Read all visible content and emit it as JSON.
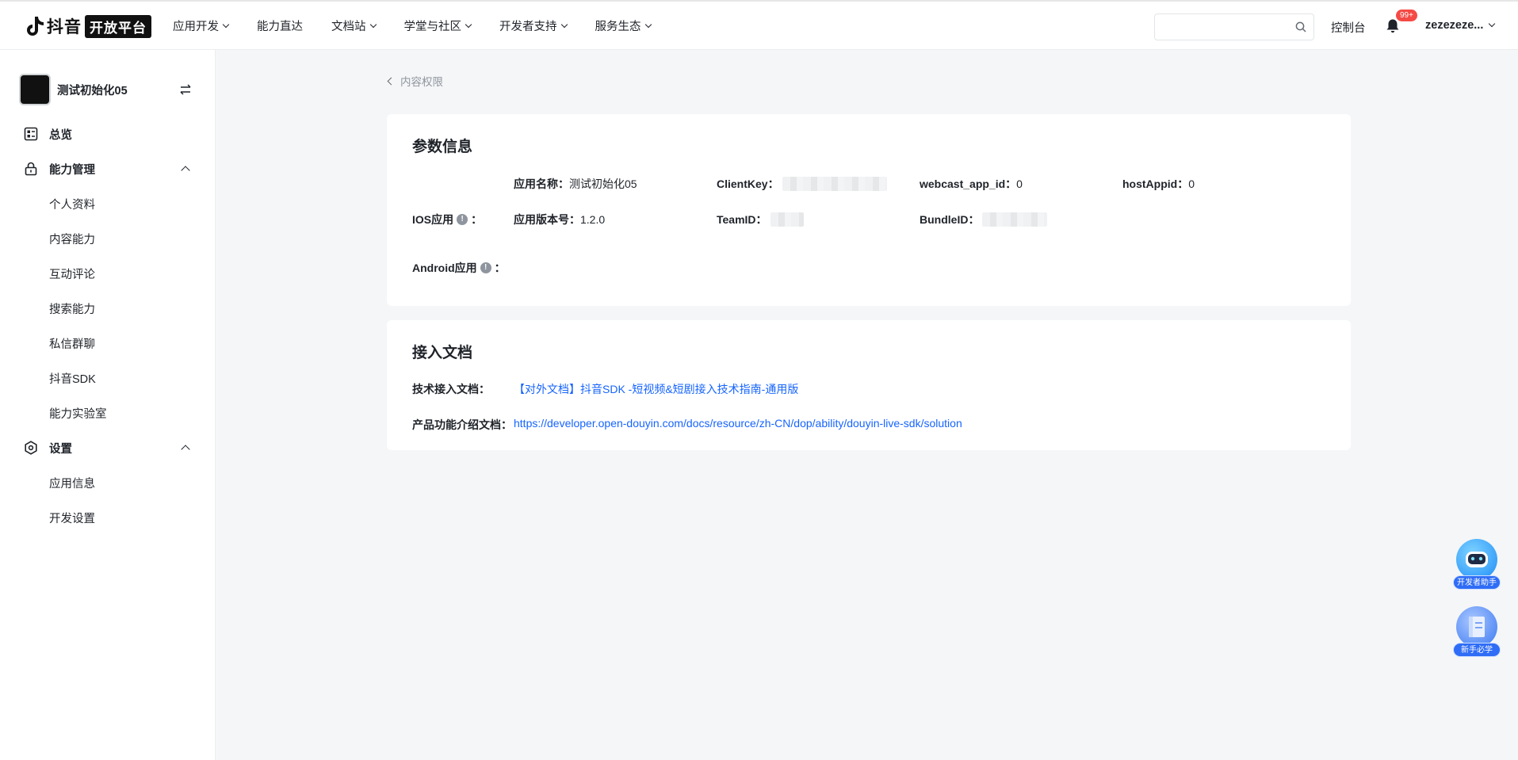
{
  "header": {
    "logo_text": "抖音",
    "logo_badge": "开放平台",
    "nav": [
      {
        "label": "应用开发",
        "dropdown": true
      },
      {
        "label": "能力直达",
        "dropdown": false
      },
      {
        "label": "文档站",
        "dropdown": true
      },
      {
        "label": "学堂与社区",
        "dropdown": true
      },
      {
        "label": "开发者支持",
        "dropdown": true
      },
      {
        "label": "服务生态",
        "dropdown": true
      }
    ],
    "search_placeholder": "",
    "console_label": "控制台",
    "notification_count": "99+",
    "username": "zezezeze..."
  },
  "sidebar": {
    "app_name": "测试初始化05",
    "groups": [
      {
        "label": "总览",
        "icon": "dashboard-icon"
      },
      {
        "label": "能力管理",
        "icon": "lock-icon",
        "expanded": true,
        "items": [
          "个人资料",
          "内容能力",
          "互动评论",
          "搜索能力",
          "私信群聊",
          "抖音SDK",
          "能力实验室"
        ]
      },
      {
        "label": "设置",
        "icon": "settings-icon",
        "expanded": true,
        "items": [
          "应用信息",
          "开发设置"
        ]
      }
    ]
  },
  "breadcrumb": {
    "label": "内容权限"
  },
  "params": {
    "title": "参数信息",
    "app_name_label": "应用名称：",
    "app_name_value": "测试初始化05",
    "clientkey_label": "ClientKey：",
    "webcast_label": "webcast_app_id：",
    "webcast_value": "0",
    "hostappid_label": "hostAppid：",
    "hostappid_value": "0",
    "ios_label": "IOS应用",
    "ios_colon": "：",
    "version_label": "应用版本号：",
    "version_value": "1.2.0",
    "teamid_label": "TeamID：",
    "bundleid_label": "BundleID：",
    "android_label": "Android应用",
    "android_colon": "：",
    "info_glyph": "!"
  },
  "docs": {
    "title": "接入文档",
    "tech_label": "技术接入文档：",
    "tech_link": "【对外文档】抖音SDK -短视频&短剧接入技术指南-通用版",
    "product_label": "产品功能介绍文档：",
    "product_link": "https://developer.open-douyin.com/docs/resource/zh-CN/dop/ability/douyin-live-sdk/solution"
  },
  "floating": {
    "assistant_label": "开发者助手",
    "newbie_label": "新手必学"
  },
  "colors": {
    "accent": "#1664ff",
    "badge": "#f54a45",
    "background": "#f5f6f7"
  }
}
